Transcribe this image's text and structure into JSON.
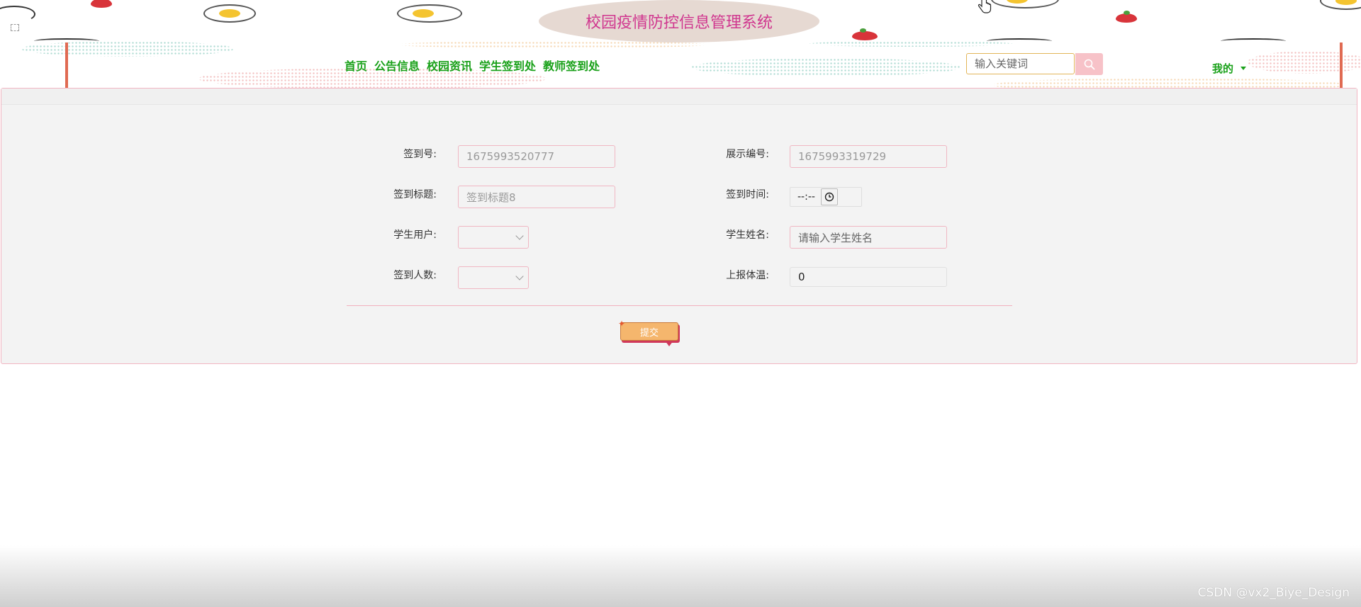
{
  "header": {
    "title": "校园疫情防控信息管理系统",
    "nav": [
      "首页",
      "公告信息",
      "校园资讯",
      "学生签到处",
      "教师签到处"
    ],
    "search_placeholder": "输入关键词",
    "user_menu_label": "我的"
  },
  "form": {
    "sign_no_label": "签到号:",
    "sign_no_value": "1675993520777",
    "display_no_label": "展示编号:",
    "display_no_value": "1675993319729",
    "sign_title_label": "签到标题:",
    "sign_title_value": "签到标题8",
    "sign_time_label": "签到时间:",
    "sign_time_value": "--:--",
    "student_user_label": "学生用户:",
    "student_name_label": "学生姓名:",
    "student_name_placeholder": "请输入学生姓名",
    "sign_count_label": "签到人数:",
    "temperature_label": "上报体温:",
    "temperature_value": "0",
    "submit_label": "提交"
  },
  "watermark": "CSDN @vx2_Biye_Design",
  "colors": {
    "nav_green": "#1aa11a",
    "title_magenta": "#d0368f",
    "field_border_pink": "#f0b7c3",
    "submit_orange": "#f5b66d"
  },
  "icons": [
    "search-icon",
    "chevron-down-icon",
    "clock-icon",
    "hand-cursor-icon"
  ]
}
